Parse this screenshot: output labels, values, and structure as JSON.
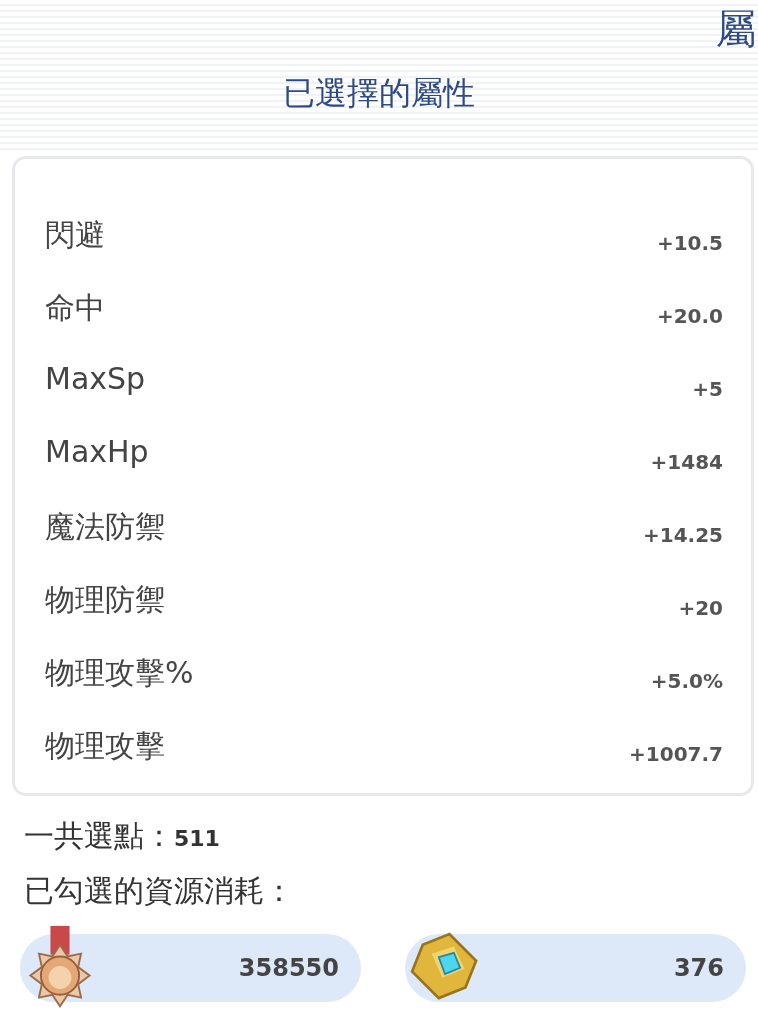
{
  "corner_title": "屬",
  "title": "已選擇的屬性",
  "attributes": [
    {
      "name": "閃避",
      "value": "+10.5"
    },
    {
      "name": "命中",
      "value": "+20.0"
    },
    {
      "name": "MaxSp",
      "value": "+5"
    },
    {
      "name": "MaxHp",
      "value": "+1484"
    },
    {
      "name": "魔法防禦",
      "value": "+14.25"
    },
    {
      "name": "物理防禦",
      "value": "+20"
    },
    {
      "name": "物理攻擊%",
      "value": "+5.0%"
    },
    {
      "name": "物理攻擊",
      "value": "+1007.7"
    }
  ],
  "total": {
    "label": "一共選點：",
    "value": "511"
  },
  "cost_label": "已勾選的資源消耗：",
  "resources": [
    {
      "kind": "medal",
      "amount": "358550"
    },
    {
      "kind": "crystal",
      "amount": "376"
    }
  ]
}
